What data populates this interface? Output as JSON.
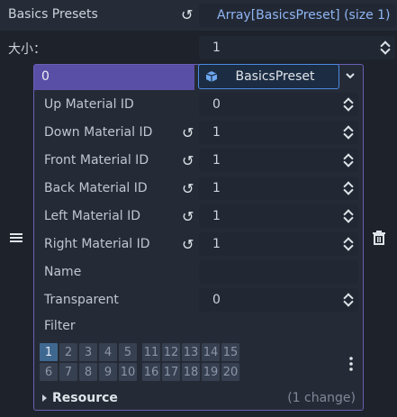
{
  "header": {
    "title": "Basics Presets",
    "value": "Array[BasicsPreset] (size 1)"
  },
  "size_row": {
    "label": "大小：",
    "value": "1"
  },
  "element": {
    "index": "0",
    "resource_type": "BasicsPreset",
    "properties": [
      {
        "label": "Up Material ID",
        "value": "0",
        "changed": false
      },
      {
        "label": "Down Material ID",
        "value": "1",
        "changed": true
      },
      {
        "label": "Front Material ID",
        "value": "1",
        "changed": true
      },
      {
        "label": "Back Material ID",
        "value": "1",
        "changed": true
      },
      {
        "label": "Left Material ID",
        "value": "1",
        "changed": true
      },
      {
        "label": "Right Material ID",
        "value": "1",
        "changed": true
      }
    ],
    "name": {
      "label": "Name",
      "value": ""
    },
    "transparent": {
      "label": "Transparent",
      "value": "0"
    },
    "filter": {
      "label": "Filter",
      "row1": [
        "1",
        "2",
        "3",
        "4",
        "5",
        "11",
        "12",
        "13",
        "14",
        "15"
      ],
      "row2": [
        "6",
        "7",
        "8",
        "9",
        "10",
        "16",
        "17",
        "18",
        "19",
        "20"
      ],
      "active": "1"
    },
    "resource_section": {
      "label": "Resource",
      "changes": "(1 change)"
    }
  },
  "icons": {
    "revert": "revert-icon",
    "drag": "drag-handle-icon",
    "delete": "trash-icon",
    "dropdown": "chevron-down-icon",
    "resource": "cube-icon",
    "more": "kebab-menu-icon"
  },
  "colors": {
    "accent": "#8fb6f5",
    "selection": "#5a4fa6",
    "filter_active": "#3f6891"
  }
}
